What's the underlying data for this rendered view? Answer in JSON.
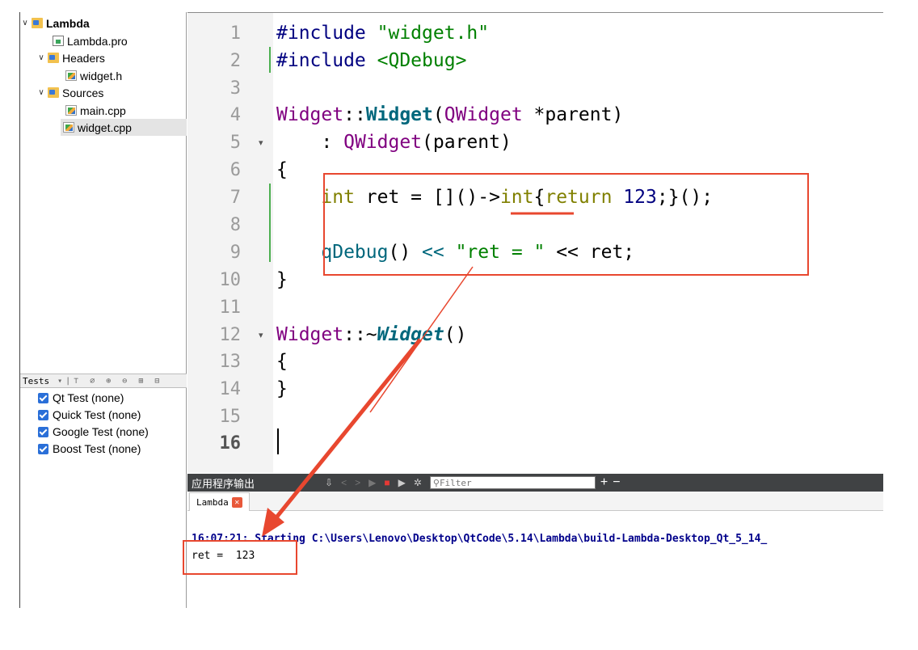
{
  "project_tree": {
    "items": [
      {
        "label": "Lambda",
        "type": "project"
      },
      {
        "label": "Lambda.pro",
        "type": "pro-file"
      },
      {
        "label": "Headers",
        "type": "folder"
      },
      {
        "label": "widget.h",
        "type": "header-file"
      },
      {
        "label": "Sources",
        "type": "folder"
      },
      {
        "label": "main.cpp",
        "type": "source-file"
      },
      {
        "label": "widget.cpp",
        "type": "source-file",
        "selected": true
      }
    ]
  },
  "tests": {
    "title": "Tests",
    "items": [
      {
        "label": "Qt Test (none)",
        "checked": true
      },
      {
        "label": "Quick Test (none)",
        "checked": true
      },
      {
        "label": "Google Test (none)",
        "checked": true
      },
      {
        "label": "Boost Test (none)",
        "checked": true
      }
    ]
  },
  "editor": {
    "current_line": "16",
    "lines": [
      {
        "n": "1"
      },
      {
        "n": "2"
      },
      {
        "n": "3"
      },
      {
        "n": "4"
      },
      {
        "n": "5"
      },
      {
        "n": "6"
      },
      {
        "n": "7"
      },
      {
        "n": "8"
      },
      {
        "n": "9"
      },
      {
        "n": "10"
      },
      {
        "n": "11"
      },
      {
        "n": "12"
      },
      {
        "n": "13"
      },
      {
        "n": "14"
      },
      {
        "n": "15"
      },
      {
        "n": "16"
      }
    ],
    "tokens": {
      "l1_prep": "#include",
      "l1_str": "\"widget.h\"",
      "l2_prep": "#include",
      "l2_str": "<QDebug>",
      "l4_cls": "Widget",
      "l4_sep": "::",
      "l4_fn": "Widget",
      "l4_p1": "(",
      "l4_type": "QWidget",
      "l4_rest": " *parent)",
      "l5_colon": ": ",
      "l5_type": "QWidget",
      "l5_rest": "(parent)",
      "l6": "{",
      "l7_kw": "int",
      "l7_a": " ret = []()->",
      "l7_kw2": "int",
      "l7_b": "{",
      "l7_kw3": "return",
      "l7_num": " 123",
      "l7_c": ";}();",
      "l9_fn": "qDebug",
      "l9_a": "() ",
      "l9_op": "<<",
      "l9_str": " \"ret = \"",
      "l9_b": " << ret;",
      "l10": "}",
      "l12_cls": "Widget",
      "l12_sep": "::~",
      "l12_fn": "Widget",
      "l12_rest": "()",
      "l13": "{",
      "l14": "}"
    }
  },
  "output": {
    "title": "应用程序输出",
    "filter_placeholder": "Filter",
    "tab_label": "Lambda",
    "lines": [
      "16:07:21: Starting C:\\Users\\Lenovo\\Desktop\\QtCode\\5.14\\Lambda\\build-Lambda-Desktop_Qt_5_14_",
      "ret =  123"
    ]
  },
  "colors": {
    "annotation": "#e8472f",
    "toolbar_bg": "#404244",
    "keyword": "#808000",
    "string": "#008000"
  }
}
